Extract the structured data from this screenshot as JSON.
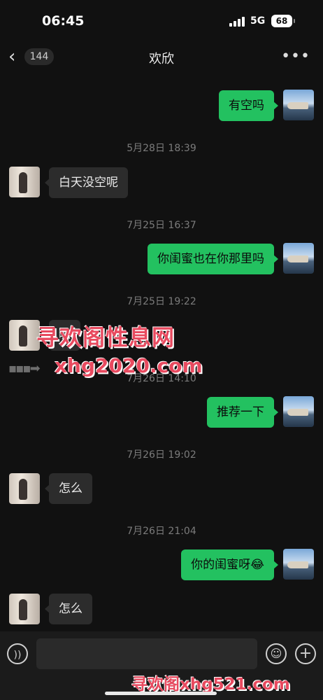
{
  "status": {
    "time": "06:45",
    "network": "5G",
    "battery": "68"
  },
  "nav": {
    "back_count": "144",
    "title": "欢欣",
    "more": "•••"
  },
  "messages": [
    {
      "side": "out",
      "text": "有空吗"
    },
    {
      "type": "time",
      "text": "5月28日 18:39"
    },
    {
      "side": "in",
      "text": "白天没空呢"
    },
    {
      "type": "time",
      "text": "7月25日 16:37"
    },
    {
      "side": "out",
      "text": "你闺蜜也在你那里吗"
    },
    {
      "type": "time",
      "text": "7月25日 19:22"
    },
    {
      "side": "in",
      "text": "嗯"
    },
    {
      "type": "time",
      "text": "7月26日 14:10"
    },
    {
      "side": "out",
      "text": "推荐一下"
    },
    {
      "type": "time",
      "text": "7月26日 19:02"
    },
    {
      "side": "in",
      "text": "怎么"
    },
    {
      "type": "time",
      "text": "7月26日 21:04"
    },
    {
      "side": "out",
      "text": "你的闺蜜呀😂"
    },
    {
      "side": "in",
      "text": "怎么"
    }
  ],
  "watermarks": {
    "line1": "寻欢阁性息网",
    "line2": "xhg2020.com",
    "bottom": "寻欢阁xhg521.com"
  },
  "input": {
    "voice_icon": "voice-icon",
    "emoji_icon": "emoji-icon",
    "plus_icon": "plus-icon"
  },
  "colors": {
    "outgoing_bubble": "#23c160",
    "incoming_bubble": "#2c2c2c",
    "background": "#111111",
    "watermark": "#e84a5f"
  }
}
